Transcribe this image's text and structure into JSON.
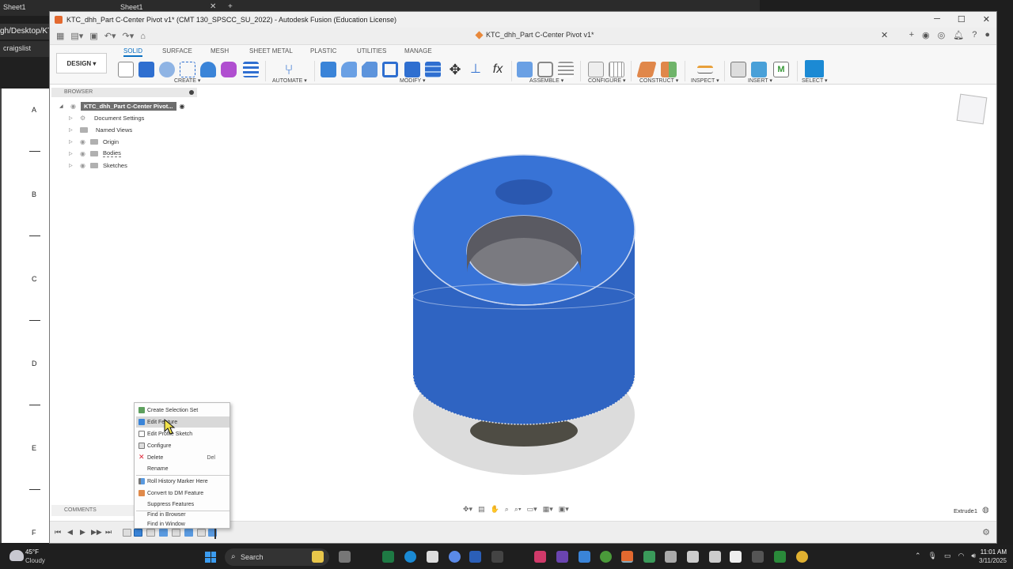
{
  "background": {
    "tabs": [
      "Sheet1",
      "Sheet1"
    ],
    "address_fragment": "gh/Desktop/KTC",
    "bookmark": "craigslist",
    "sheet_rows": [
      "A",
      "B",
      "C",
      "D",
      "E",
      "F"
    ]
  },
  "fusion": {
    "window_title": "KTC_dhh_Part C-Center Pivot v1* (CMT 130_SPSCC_SU_2022) - Autodesk Fusion (Education License)",
    "document_tab": "KTC_dhh_Part C-Center Pivot v1*",
    "workspace_button": "DESIGN",
    "ribbon_tabs": [
      "SOLID",
      "SURFACE",
      "MESH",
      "SHEET METAL",
      "PLASTIC",
      "UTILITIES",
      "MANAGE"
    ],
    "active_tab": "SOLID",
    "groups": {
      "create": "CREATE",
      "automate": "AUTOMATE",
      "modify": "MODIFY",
      "assemble": "ASSEMBLE",
      "configure": "CONFIGURE",
      "construct": "CONSTRUCT",
      "inspect": "INSPECT",
      "insert": "INSERT",
      "select": "SELECT"
    },
    "browser": {
      "header": "BROWSER",
      "root": "KTC_dhh_Part C-Center Pivot...",
      "items": [
        "Document Settings",
        "Named Views",
        "Origin",
        "Bodies",
        "Sketches"
      ]
    },
    "context_menu": {
      "items": [
        "Create Selection Set",
        "Edit Feature",
        "Edit Profile Sketch",
        "Configure",
        "Delete",
        "Rename",
        "Roll History Marker Here",
        "Convert to DM Feature",
        "Suppress Features",
        "Find in Browser",
        "Find in Window"
      ],
      "delete_shortcut": "Del"
    },
    "comments_label": "COMMENTS",
    "status_feature": "Extrude1",
    "model_color": "#2f64c2"
  },
  "taskbar": {
    "temperature": "45°F",
    "weather": "Cloudy",
    "search_placeholder": "Search",
    "time": "11:01 AM",
    "date": "3/11/2025"
  }
}
